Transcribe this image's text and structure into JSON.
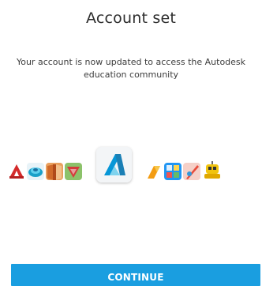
{
  "title": "Account set",
  "subtitle": "Your account is now updated to access the Autodesk education community",
  "apps": [
    {
      "icon": "autocad-icon",
      "color": "#d42a2a"
    },
    {
      "icon": "maya-icon",
      "color": "#1aa0c8"
    },
    {
      "icon": "revit-icon",
      "color": "#e08a3a"
    },
    {
      "icon": "inventor-icon",
      "color": "#d33b3b"
    },
    {
      "icon": "autodesk-logo-icon",
      "color": "#0696d7"
    },
    {
      "icon": "fusion-icon",
      "color": "#f39c12"
    },
    {
      "icon": "sketchbook-icon",
      "color": "#2196f3"
    },
    {
      "icon": "mudbox-icon",
      "color": "#e74c3c"
    },
    {
      "icon": "instructables-robot-icon",
      "color": "#f1c40f"
    }
  ],
  "continue_label": "CONTINUE",
  "colors": {
    "accent": "#1a9ee0",
    "text": "#2d2d2d"
  }
}
